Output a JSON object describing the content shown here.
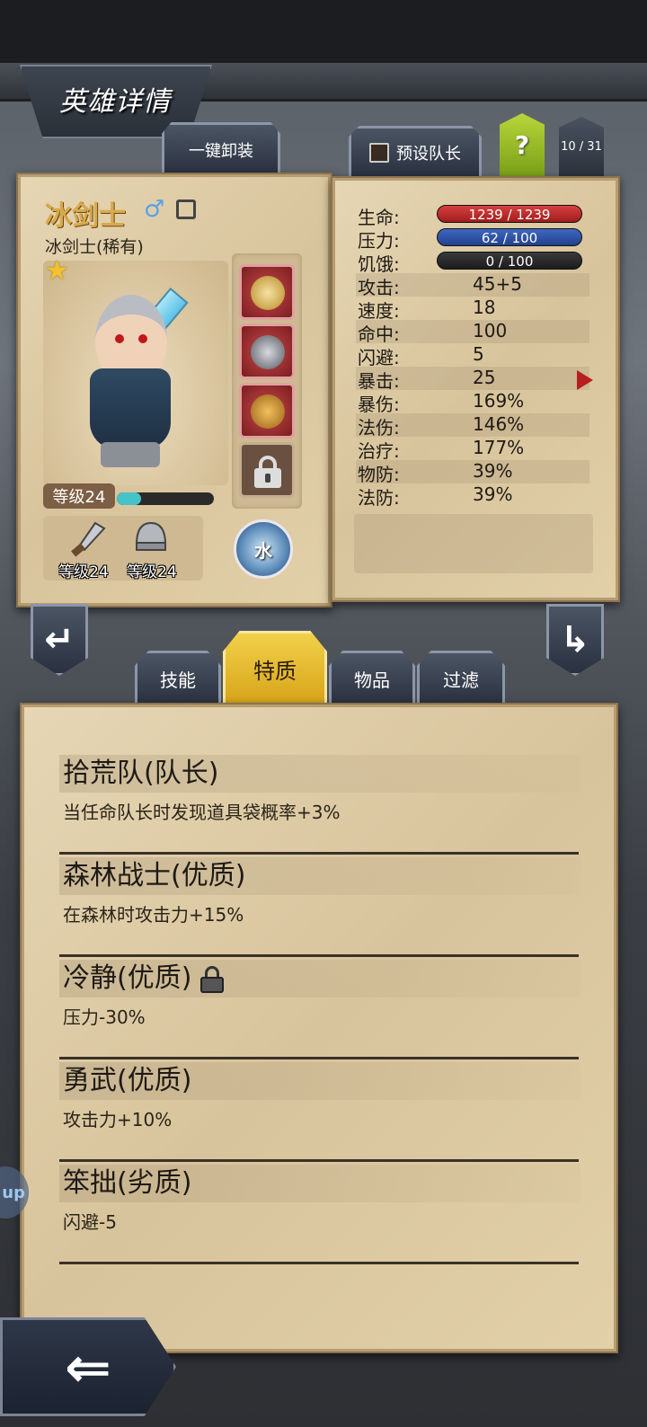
{
  "header": {
    "title": "英雄详情"
  },
  "toolbar": {
    "unequip_all": "一键卸装",
    "preset_captain": "预设队长",
    "help": "?",
    "hero_counter": "10 / 31"
  },
  "hero": {
    "name": "冰剑士",
    "class": "冰剑士(稀有)",
    "stars": 1,
    "level_label": "等级24",
    "xp_fraction": 0.25,
    "weapon_level": "等级24",
    "armor_level": "等级24",
    "element": "水",
    "equipment": [
      "helmet-gear-icon",
      "boots-gear-icon",
      "bell-helmet-gear-icon",
      "locked-slot"
    ]
  },
  "stats": [
    {
      "key": "生命:",
      "value": "1239 / 1239",
      "bar": "hp"
    },
    {
      "key": "压力:",
      "value": "62 / 100",
      "bar": "st"
    },
    {
      "key": "饥饿:",
      "value": "0 / 100",
      "bar": "hu"
    },
    {
      "key": "攻击:",
      "value": "45+5"
    },
    {
      "key": "速度:",
      "value": "18"
    },
    {
      "key": "命中:",
      "value": "100"
    },
    {
      "key": "闪避:",
      "value": "5"
    },
    {
      "key": "暴击:",
      "value": "25"
    },
    {
      "key": "暴伤:",
      "value": "169%"
    },
    {
      "key": "法伤:",
      "value": "146%"
    },
    {
      "key": "治疗:",
      "value": "177%"
    },
    {
      "key": "物防:",
      "value": "39%"
    },
    {
      "key": "法防:",
      "value": "39%"
    }
  ],
  "tabs": [
    "技能",
    "特质",
    "物品",
    "过滤"
  ],
  "active_tab": "特质",
  "traits": [
    {
      "name": "拾荒队(队长)",
      "desc": "当任命队长时发现道具袋概率+3%",
      "locked": false
    },
    {
      "name": "森林战士(优质)",
      "desc": "在森林时攻击力+15%",
      "locked": false
    },
    {
      "name": "冷静(优质)",
      "desc": "压力-30%",
      "locked": true
    },
    {
      "name": "勇武(优质)",
      "desc": "攻击力+10%",
      "locked": false
    },
    {
      "name": "笨拙(劣质)",
      "desc": "闪避-5",
      "locked": false
    }
  ],
  "side_bubble": "up",
  "colors": {
    "accent_gold": "#f2d04a",
    "hp_red": "#d84040",
    "stress_blue": "#3e68c0",
    "xp_cyan": "#46c3c8",
    "name_gold": "#d9a94a"
  }
}
